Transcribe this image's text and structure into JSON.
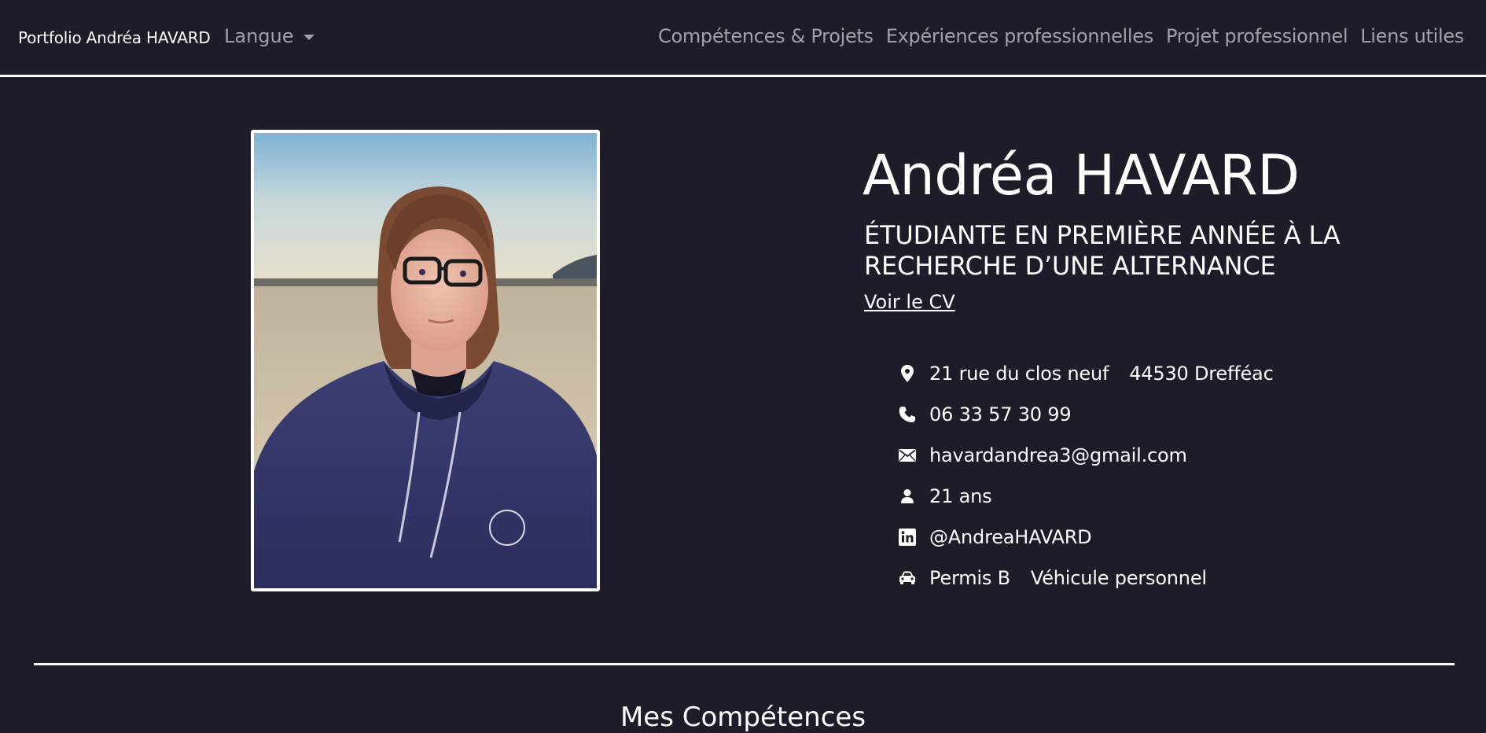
{
  "nav": {
    "brand": "Portfolio Andréa HAVARD",
    "language_label": "Langue",
    "links": [
      "Compétences & Projets",
      "Expériences professionnelles",
      "Projet professionnel",
      "Liens utiles"
    ]
  },
  "hero": {
    "name": "Andréa HAVARD",
    "subtitle": "ÉTUDIANTE EN PREMIÈRE ANNÉE À LA RECHERCHE D’UNE ALTERNANCE",
    "cv_link": "Voir le CV"
  },
  "info": {
    "address_street": "21 rue du clos neuf",
    "address_city": "44530 Drefféac",
    "phone": "06 33 57 30 99",
    "email": "havardandrea3@gmail.com",
    "age": "21 ans",
    "linkedin": "@AndreaHAVARD",
    "license": "Permis B",
    "vehicle": "Véhicule personnel"
  },
  "sections": {
    "competences_title": "Mes Compétences"
  },
  "icons": [
    "map-pin-icon",
    "phone-icon",
    "envelope-icon",
    "person-icon",
    "linkedin-icon",
    "car-icon",
    "chevron-down-icon"
  ],
  "colors": {
    "background": "#1e1c29",
    "text": "#ffffff",
    "nav_muted": "#a2a1a7"
  }
}
